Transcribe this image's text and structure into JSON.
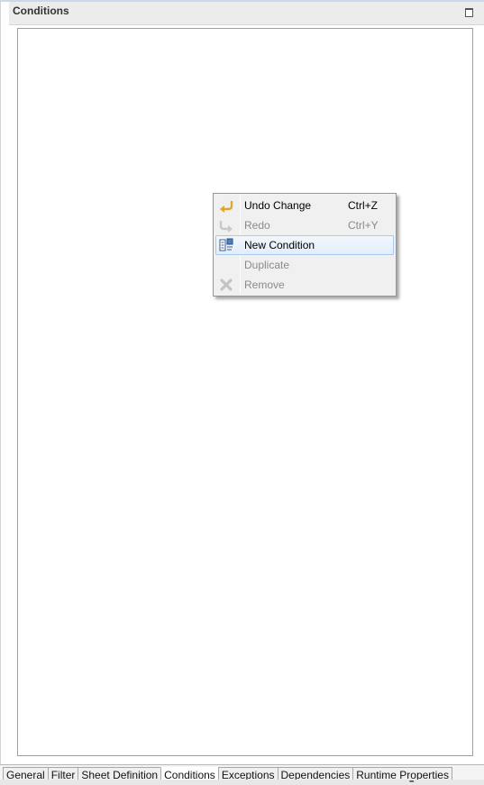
{
  "panel": {
    "title": "Conditions"
  },
  "context_menu": {
    "items": [
      {
        "label": "Undo Change",
        "shortcut": "Ctrl+Z",
        "icon": "undo-icon",
        "enabled": true
      },
      {
        "label": "Redo",
        "shortcut": "Ctrl+Y",
        "icon": "redo-icon",
        "enabled": false
      },
      {
        "label": "New Condition",
        "shortcut": "",
        "icon": "new-condition-icon",
        "enabled": true,
        "highlighted": true
      },
      {
        "label": "Duplicate",
        "shortcut": "",
        "icon": "",
        "enabled": false
      },
      {
        "label": "Remove",
        "shortcut": "",
        "icon": "remove-icon",
        "enabled": false
      }
    ]
  },
  "tabs": [
    {
      "label": "General"
    },
    {
      "label": "Filter"
    },
    {
      "label": "Sheet Definition"
    },
    {
      "label": "Conditions",
      "active": true
    },
    {
      "label": "Exceptions"
    },
    {
      "label": "Dependencies"
    },
    {
      "label": "Runtime Properties"
    }
  ],
  "colors": {
    "highlight_border": "#a8c8ef",
    "disabled_text": "#8a8a8a",
    "undo_icon": "#e0a72a"
  }
}
